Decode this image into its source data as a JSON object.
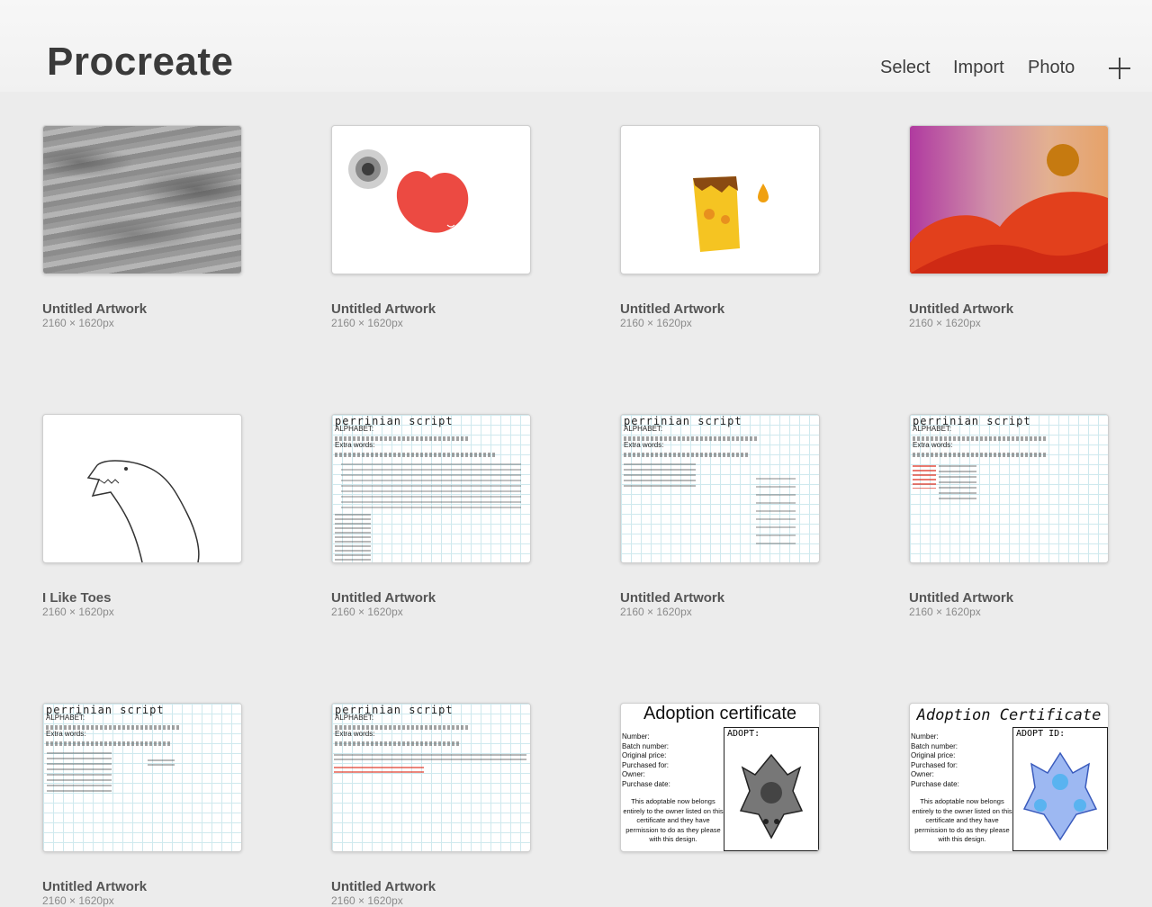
{
  "app_title": "Procreate",
  "toolbar": {
    "select_label": "Select",
    "import_label": "Import",
    "photo_label": "Photo"
  },
  "artworks": [
    {
      "title": "Untitled Artwork",
      "size": "2160 × 1620px"
    },
    {
      "title": "Untitled Artwork",
      "size": "2160 × 1620px"
    },
    {
      "title": "Untitled Artwork",
      "size": "2160 × 1620px"
    },
    {
      "title": "Untitled Artwork",
      "size": "2160 × 1620px"
    },
    {
      "title": "I Like Toes",
      "size": "2160 × 1620px"
    },
    {
      "title": "Untitled Artwork",
      "size": "2160 × 1620px"
    },
    {
      "title": "Untitled Artwork",
      "size": "2160 × 1620px"
    },
    {
      "title": "Untitled Artwork",
      "size": "2160 × 1620px"
    },
    {
      "title": "Untitled Artwork",
      "size": "2160 × 1620px"
    },
    {
      "title": "Untitled Artwork",
      "size": "2160 × 1620px"
    }
  ],
  "thumb_text": {
    "script_title": "perrinian script",
    "alphabet": "ALPHABET:",
    "extra_words": "Extra words:",
    "cert_a_title": "Adoption certificate",
    "cert_b_title": "Adoption Certificate",
    "cert_fields": "Number:\nBatch number:\nOriginal price:\nPurchased for:\nOwner:\nPurchase date:",
    "cert_note": "This adoptable now belongs entirely to the owner listed on this certificate and they have permission to do as they please with this design.",
    "cert_a_box": "ADOPT:",
    "cert_b_box": "ADOPT ID:"
  },
  "colors": {
    "background": "#ececec",
    "title_text": "#3a3a3a"
  }
}
